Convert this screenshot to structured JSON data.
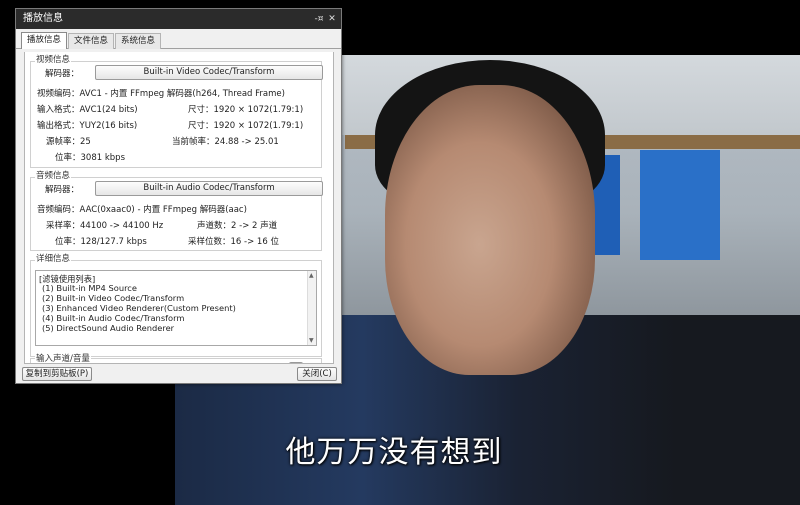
{
  "subtitle": "他万万没有想到",
  "dialog": {
    "title": "播放信息",
    "pin_icon": "pin-icon",
    "close_icon": "close-icon",
    "tabs": [
      {
        "label": "播放信息",
        "active": true
      },
      {
        "label": "文件信息",
        "active": false
      },
      {
        "label": "系统信息",
        "active": false
      }
    ],
    "video": {
      "group_title": "视频信息",
      "decoder_label": "解码器：",
      "decoder_value": "Built-in Video Codec/Transform",
      "codec_label": "视频编码：",
      "codec_value": "AVC1 - 内置 FFmpeg 解码器(h264, Thread Frame)",
      "input_label": "输入格式：",
      "input_value": "AVC1(24 bits)",
      "input_size_label": "尺寸：",
      "input_size_value": "1920 × 1072(1.79:1)",
      "output_label": "输出格式：",
      "output_value": "YUY2(16 bits)",
      "output_size_label": "尺寸：",
      "output_size_value": "1920 × 1072(1.79:1)",
      "src_fps_label": "源帧率：",
      "src_fps_value": "25",
      "cur_fps_label": "当前帧率：",
      "cur_fps_value": "24.88 -> 25.01",
      "bitrate_label": "位率：",
      "bitrate_value": "3081 kbps"
    },
    "audio": {
      "group_title": "音频信息",
      "decoder_label": "解码器：",
      "decoder_value": "Built-in Audio Codec/Transform",
      "codec_label": "音频编码：",
      "codec_value": "AAC(0xaac0) - 内置 FFmpeg 解码器(aac)",
      "rate_label": "采样率：",
      "rate_value": "44100 -> 44100 Hz",
      "channels_label": "声道数：",
      "channels_value": "2 -> 2 声道",
      "bitrate_label": "位率：",
      "bitrate_value": "128/127.7 kbps",
      "depth_label": "采样位数：",
      "depth_value": "16 -> 16 位"
    },
    "details": {
      "group_title": "详细信息",
      "lines": [
        "[滤镜使用列表]",
        "(1) Built-in MP4 Source",
        "(2) Built-in Video Codec/Transform",
        "(3) Enhanced Video Renderer(Custom Present)",
        "(4) Built-in Audio Codec/Transform",
        "(5) DirectSound Audio Renderer"
      ]
    },
    "channel_group_title": "输入声道/音量",
    "copy_button": "复制到剪贴板(P)",
    "close_button": "关闭(C)"
  }
}
